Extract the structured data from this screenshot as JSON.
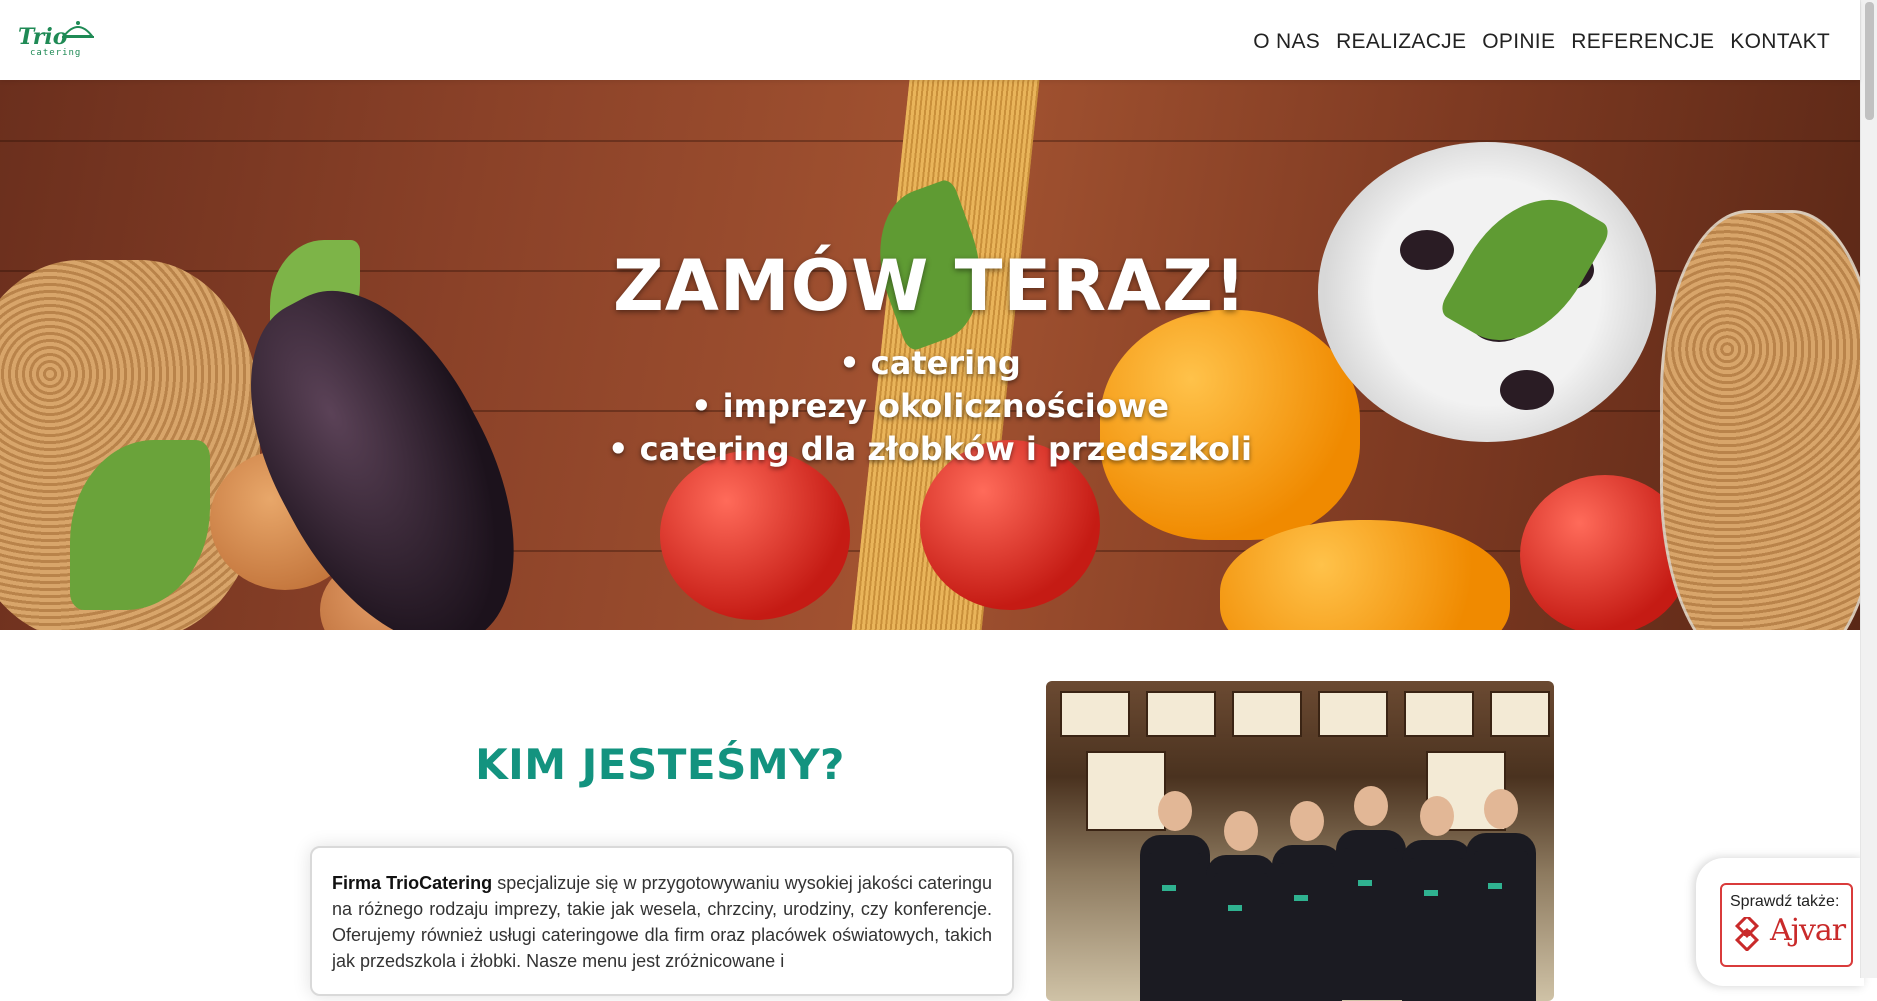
{
  "header": {
    "logo": {
      "brand": "Trio",
      "sub": "catering"
    },
    "nav": [
      "O NAS",
      "REALIZACJE",
      "OPINIE",
      "REFERENCJE",
      "KONTAKT"
    ]
  },
  "hero": {
    "title": "ZAMÓW TERAZ!",
    "lines": [
      "• catering",
      "• imprezy okolicznościowe",
      "• catering dla złobków i przedszkoli"
    ]
  },
  "about": {
    "title": "KIM JESTEŚMY?",
    "lead": "Firma TrioCatering",
    "body": " specjalizuje się w przygotowywaniu wysokiej jakości cateringu na różnego rodzaju imprezy, takie jak wesela, chrzciny, urodziny, czy konferencje. Oferujemy również usługi cateringowe dla firm oraz placówek oświatowych, takich jak przedszkola i żłobki. Nasze menu jest zróżnicowane i"
  },
  "side_badge": {
    "label": "Sprawdź także:",
    "brand": "Ajvar"
  },
  "colors": {
    "accent": "#13937f",
    "badge_red": "#c92a2a"
  }
}
